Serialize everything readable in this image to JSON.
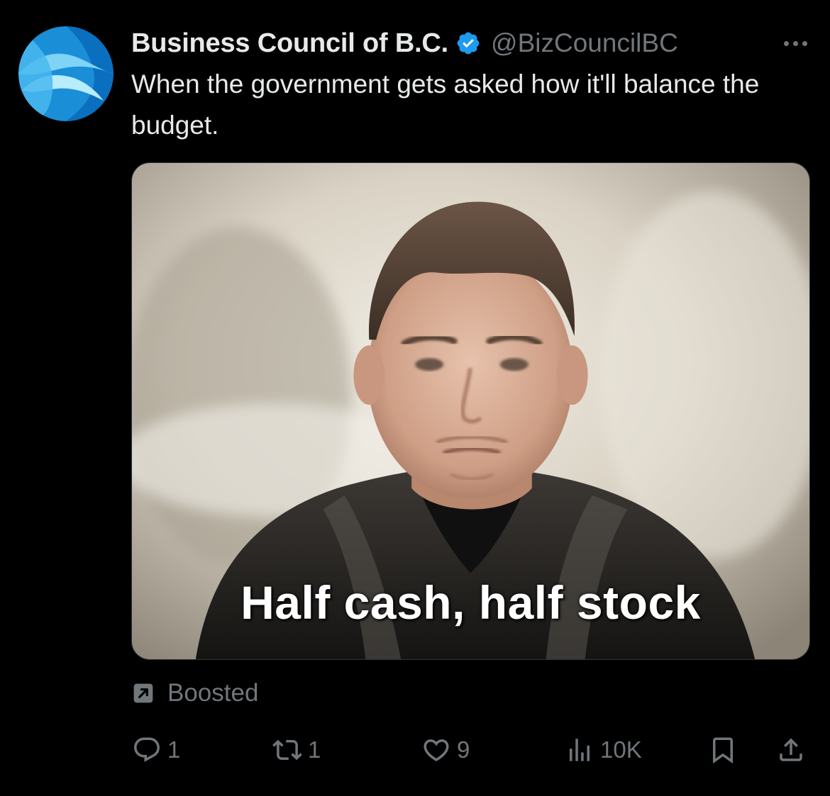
{
  "author": {
    "display_name": "Business Council of B.C.",
    "handle": "@BizCouncilBC",
    "verified": true,
    "avatar_icon": "business-council-logo"
  },
  "tweet": {
    "text": "When the government gets asked how it'll balance the budget.",
    "media_caption": "Half cash, half stock"
  },
  "promo": {
    "label": "Boosted",
    "icon": "boost-arrow-icon"
  },
  "actions": {
    "reply_count": "1",
    "repost_count": "1",
    "like_count": "9",
    "views_count": "10K"
  },
  "colors": {
    "background": "#000000",
    "primary_text": "#e7e9ea",
    "secondary_text": "#71767b",
    "verified_blue": "#1d9bf0"
  }
}
